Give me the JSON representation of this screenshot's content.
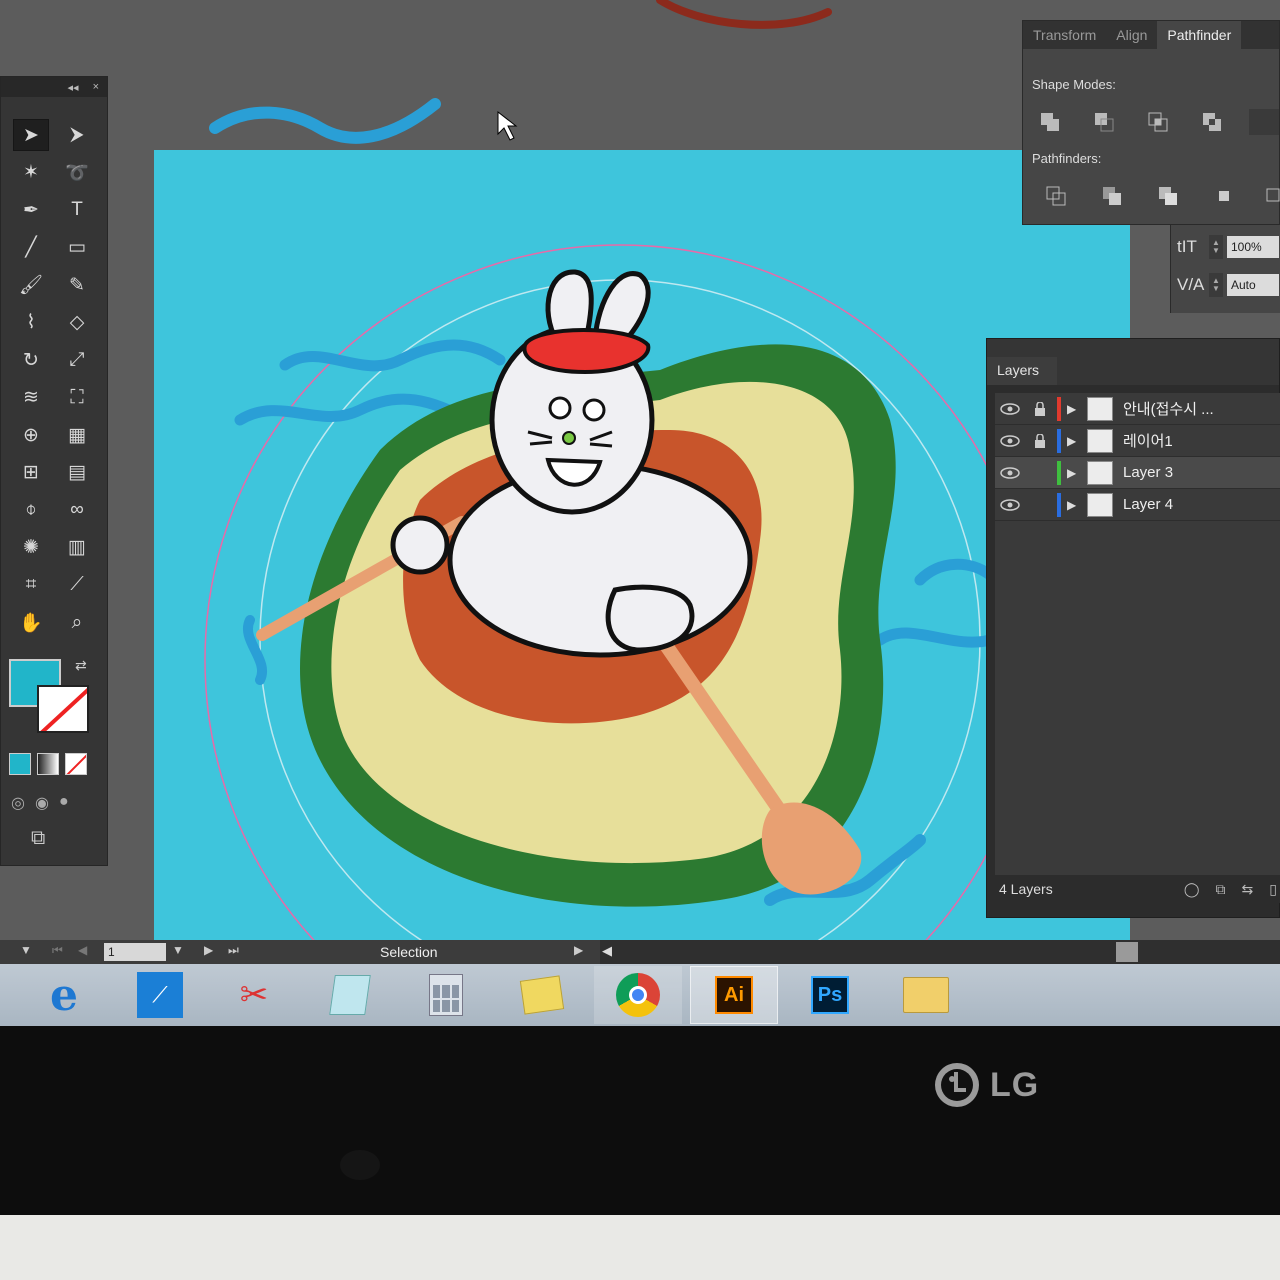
{
  "app": "Adobe Illustrator",
  "tools_panel": {
    "collapse_glyph": "◂◂",
    "close_glyph": "×",
    "tools": [
      "selection-tool",
      "direct-selection-tool",
      "magic-wand-tool",
      "lasso-tool",
      "pen-tool",
      "type-tool",
      "line-tool",
      "rectangle-tool",
      "paintbrush-tool",
      "pencil-tool",
      "blob-brush-tool",
      "eraser-tool",
      "rotate-tool",
      "scale-tool",
      "warp-tool",
      "free-transform-tool",
      "shape-builder-tool",
      "perspective-grid-tool",
      "mesh-tool",
      "gradient-tool",
      "eyedropper-tool",
      "blend-tool",
      "symbol-sprayer-tool",
      "column-graph-tool",
      "artboard-tool",
      "slice-tool",
      "hand-tool",
      "zoom-tool"
    ],
    "fill_color": "#21b5c9",
    "stroke": "none"
  },
  "pathfinder_panel": {
    "tabs": [
      "Transform",
      "Align",
      "Pathfinder"
    ],
    "active_tab": "Pathfinder",
    "shape_modes_label": "Shape Modes:",
    "pathfinders_label": "Pathfinders:"
  },
  "character_panel": {
    "leading_icon": "tIT",
    "leading_value": "100%",
    "tracking_icon": "V/A",
    "tracking_value": "Auto"
  },
  "layers_panel": {
    "title": "Layers",
    "layers": [
      {
        "name": "안내(접수시 ...",
        "locked": true,
        "color": "#e03a2e",
        "active": false
      },
      {
        "name": "레이어1",
        "locked": true,
        "color": "#2a6de0",
        "active": false
      },
      {
        "name": "Layer 3",
        "locked": false,
        "color": "#3fbf3f",
        "active": true
      },
      {
        "name": "Layer 4",
        "locked": false,
        "color": "#2a6de0",
        "active": false
      }
    ],
    "count_label": "4 Layers"
  },
  "status_bar": {
    "page_number": "1",
    "status_text": "Selection"
  },
  "taskbar": {
    "apps": [
      "internet-explorer",
      "scanner",
      "paint",
      "notepad",
      "calculator",
      "sticky-notes",
      "chrome",
      "Ai",
      "Ps",
      "file-explorer"
    ],
    "active_app": "Ai"
  },
  "bezel": {
    "brand": "LG"
  },
  "colors": {
    "canvas_bg": "#3ec5dc",
    "avocado_dark": "#2c7a31",
    "avocado_flesh": "#e7df9a",
    "pit": "#c8552b",
    "hat": "#e8322e",
    "paddle": "#e8a072",
    "water": "#2a9fd6"
  }
}
